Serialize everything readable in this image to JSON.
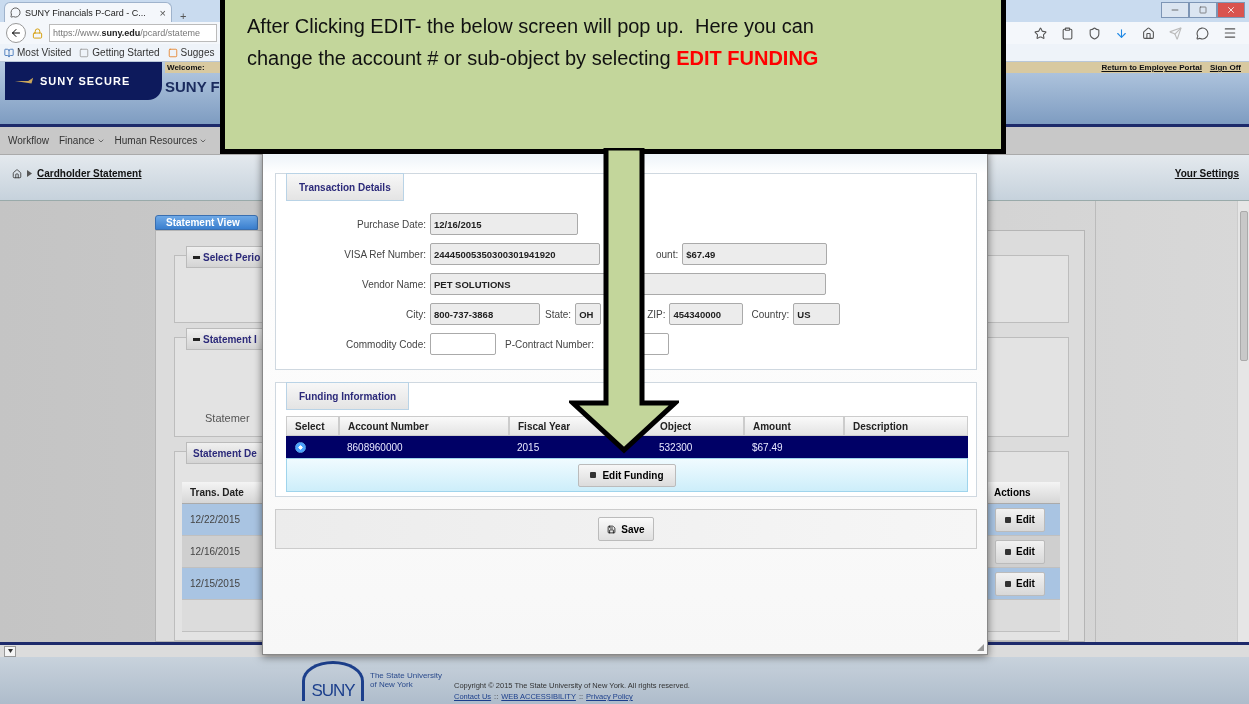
{
  "browser": {
    "tab_title": "SUNY Financials P-Card - C...",
    "tab_close": "×",
    "new_tab": "+",
    "url": "https://www.**suny.edu**/pcard/stateme",
    "bookmarks": [
      "Most Visited",
      "Getting Started",
      "Sugges"
    ]
  },
  "header": {
    "logo": "SUNY SECURE",
    "welcome": "Welcome:",
    "title": "SUNY F",
    "links": [
      "Return to Employee Portal",
      "Sign Off"
    ]
  },
  "menu": [
    {
      "label": "Workflow",
      "has_dropdown": false
    },
    {
      "label": "Finance",
      "has_dropdown": true
    },
    {
      "label": "Human Resources",
      "has_dropdown": true
    }
  ],
  "breadcrumb": {
    "items": [
      "Cardholder Statement"
    ],
    "settings": "Your Settings"
  },
  "statement": {
    "tab": "Statement View",
    "sections": [
      {
        "title": "Select Perio",
        "collapsible": true
      },
      {
        "title": "Statement I",
        "collapsible": true,
        "text": "Statemer"
      },
      {
        "title": "Statement De",
        "collapsible": false
      }
    ],
    "table": {
      "columns": [
        "Trans. Date",
        "Actions"
      ],
      "rows": [
        {
          "date": "12/22/2015",
          "action": "Edit"
        },
        {
          "date": "12/16/2015",
          "action": "Edit"
        },
        {
          "date": "12/15/2015",
          "action": "Edit"
        }
      ]
    }
  },
  "dialog": {
    "transaction": {
      "title": "Transaction Details",
      "purchase_date": {
        "label": "Purchase Date:",
        "value": "12/16/2015",
        "readonly": true
      },
      "visa_ref": {
        "label": "VISA Ref Number:",
        "value": "24445005350300301941920",
        "readonly": true
      },
      "amount": {
        "label": "ount:",
        "value": "$67.49",
        "readonly": true
      },
      "vendor": {
        "label": "Vendor Name:",
        "value": "PET SOLUTIONS",
        "readonly": true
      },
      "city": {
        "label": "City:",
        "value": "800-737-3868",
        "readonly": true
      },
      "state": {
        "label": "State:",
        "value": "OH",
        "readonly": true
      },
      "zip": {
        "label": "ZIP:",
        "value": "454340000",
        "readonly": true
      },
      "country": {
        "label": "Country:",
        "value": "US",
        "readonly": true
      },
      "commodity_code": {
        "label": "Commodity Code:",
        "readonly": false
      },
      "p_contract": {
        "label": "P-Contract Number:",
        "readonly": false
      }
    },
    "funding": {
      "title": "Funding Information",
      "columns": [
        "Select",
        "Account Number",
        "Fiscal Year",
        "Object",
        "Amount",
        "Description"
      ],
      "rows": [
        {
          "selected": true,
          "account_number": "8608960000",
          "fiscal_year": "2015",
          "object": "532300",
          "amount": "$67.49"
        }
      ],
      "edit_button": "Edit Funding"
    },
    "save_button": "Save"
  },
  "callout": {
    "lines": [
      "After Clicking EDIT- the below screen will pop up.  Here you can",
      "change the account # or sub-object by selecting **EDIT FUNDING**"
    ]
  },
  "footer": {
    "logo": "SUNY",
    "university": "The State University of New York",
    "copyright": "Copyright © 2015 The State University of New York. All rights reserved.",
    "links": [
      "Contact Us",
      "WEB ACCESSIBILITY",
      "Privacy Policy"
    ],
    "separator": "::"
  }
}
